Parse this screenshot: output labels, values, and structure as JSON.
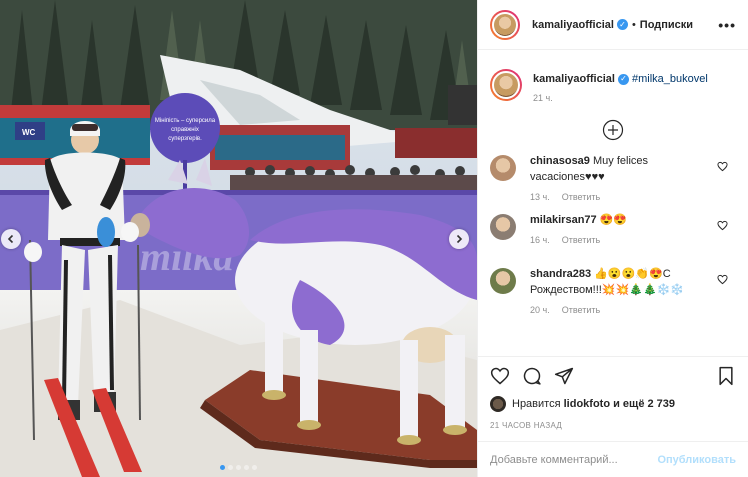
{
  "header": {
    "username": "kamaliyaofficial",
    "separator": "•",
    "follow_label": "Подписки",
    "more_icon": "more-dots-icon"
  },
  "caption": {
    "username": "kamaliyaofficial",
    "hashtag": "#milka_bukovel",
    "age": "21 ч."
  },
  "photo": {
    "sign_text": [
      "Мініпість – суперсила",
      "справжніх",
      "суперзгерів."
    ],
    "banner_text": "milka",
    "shop_sign": "WC",
    "carousel_count": 5,
    "carousel_active": 0
  },
  "comments": [
    {
      "username": "chinasosa9",
      "text": "Muy felices vacaciones♥♥♥",
      "age": "13 ч.",
      "reply": "Ответить",
      "avatar_color": "#b58b6b"
    },
    {
      "username": "milakirsan77",
      "text": "😍😍",
      "age": "16 ч.",
      "reply": "Ответить",
      "avatar_color": "#8b7d72"
    },
    {
      "username": "shandra283",
      "text": "👍😮😮👏😍С Рождеством!!!💥💥🎄🎄❄️❄️",
      "age": "20 ч.",
      "reply": "Ответить",
      "avatar_color": "#6e7b4a"
    }
  ],
  "likes": {
    "prefix": "Нравится",
    "user": "lidokfoto",
    "and_more": "и ещё 2 739"
  },
  "timestamp": "21 ЧАСОВ НАЗАД",
  "add_comment": {
    "placeholder": "Добавьте комментарий...",
    "publish_label": "Опубликовать"
  },
  "colors": {
    "accent": "#3897f0",
    "publish_disabled": "#b2dffc",
    "muted": "#8e8e8e",
    "milka": "#7c5cc4"
  }
}
